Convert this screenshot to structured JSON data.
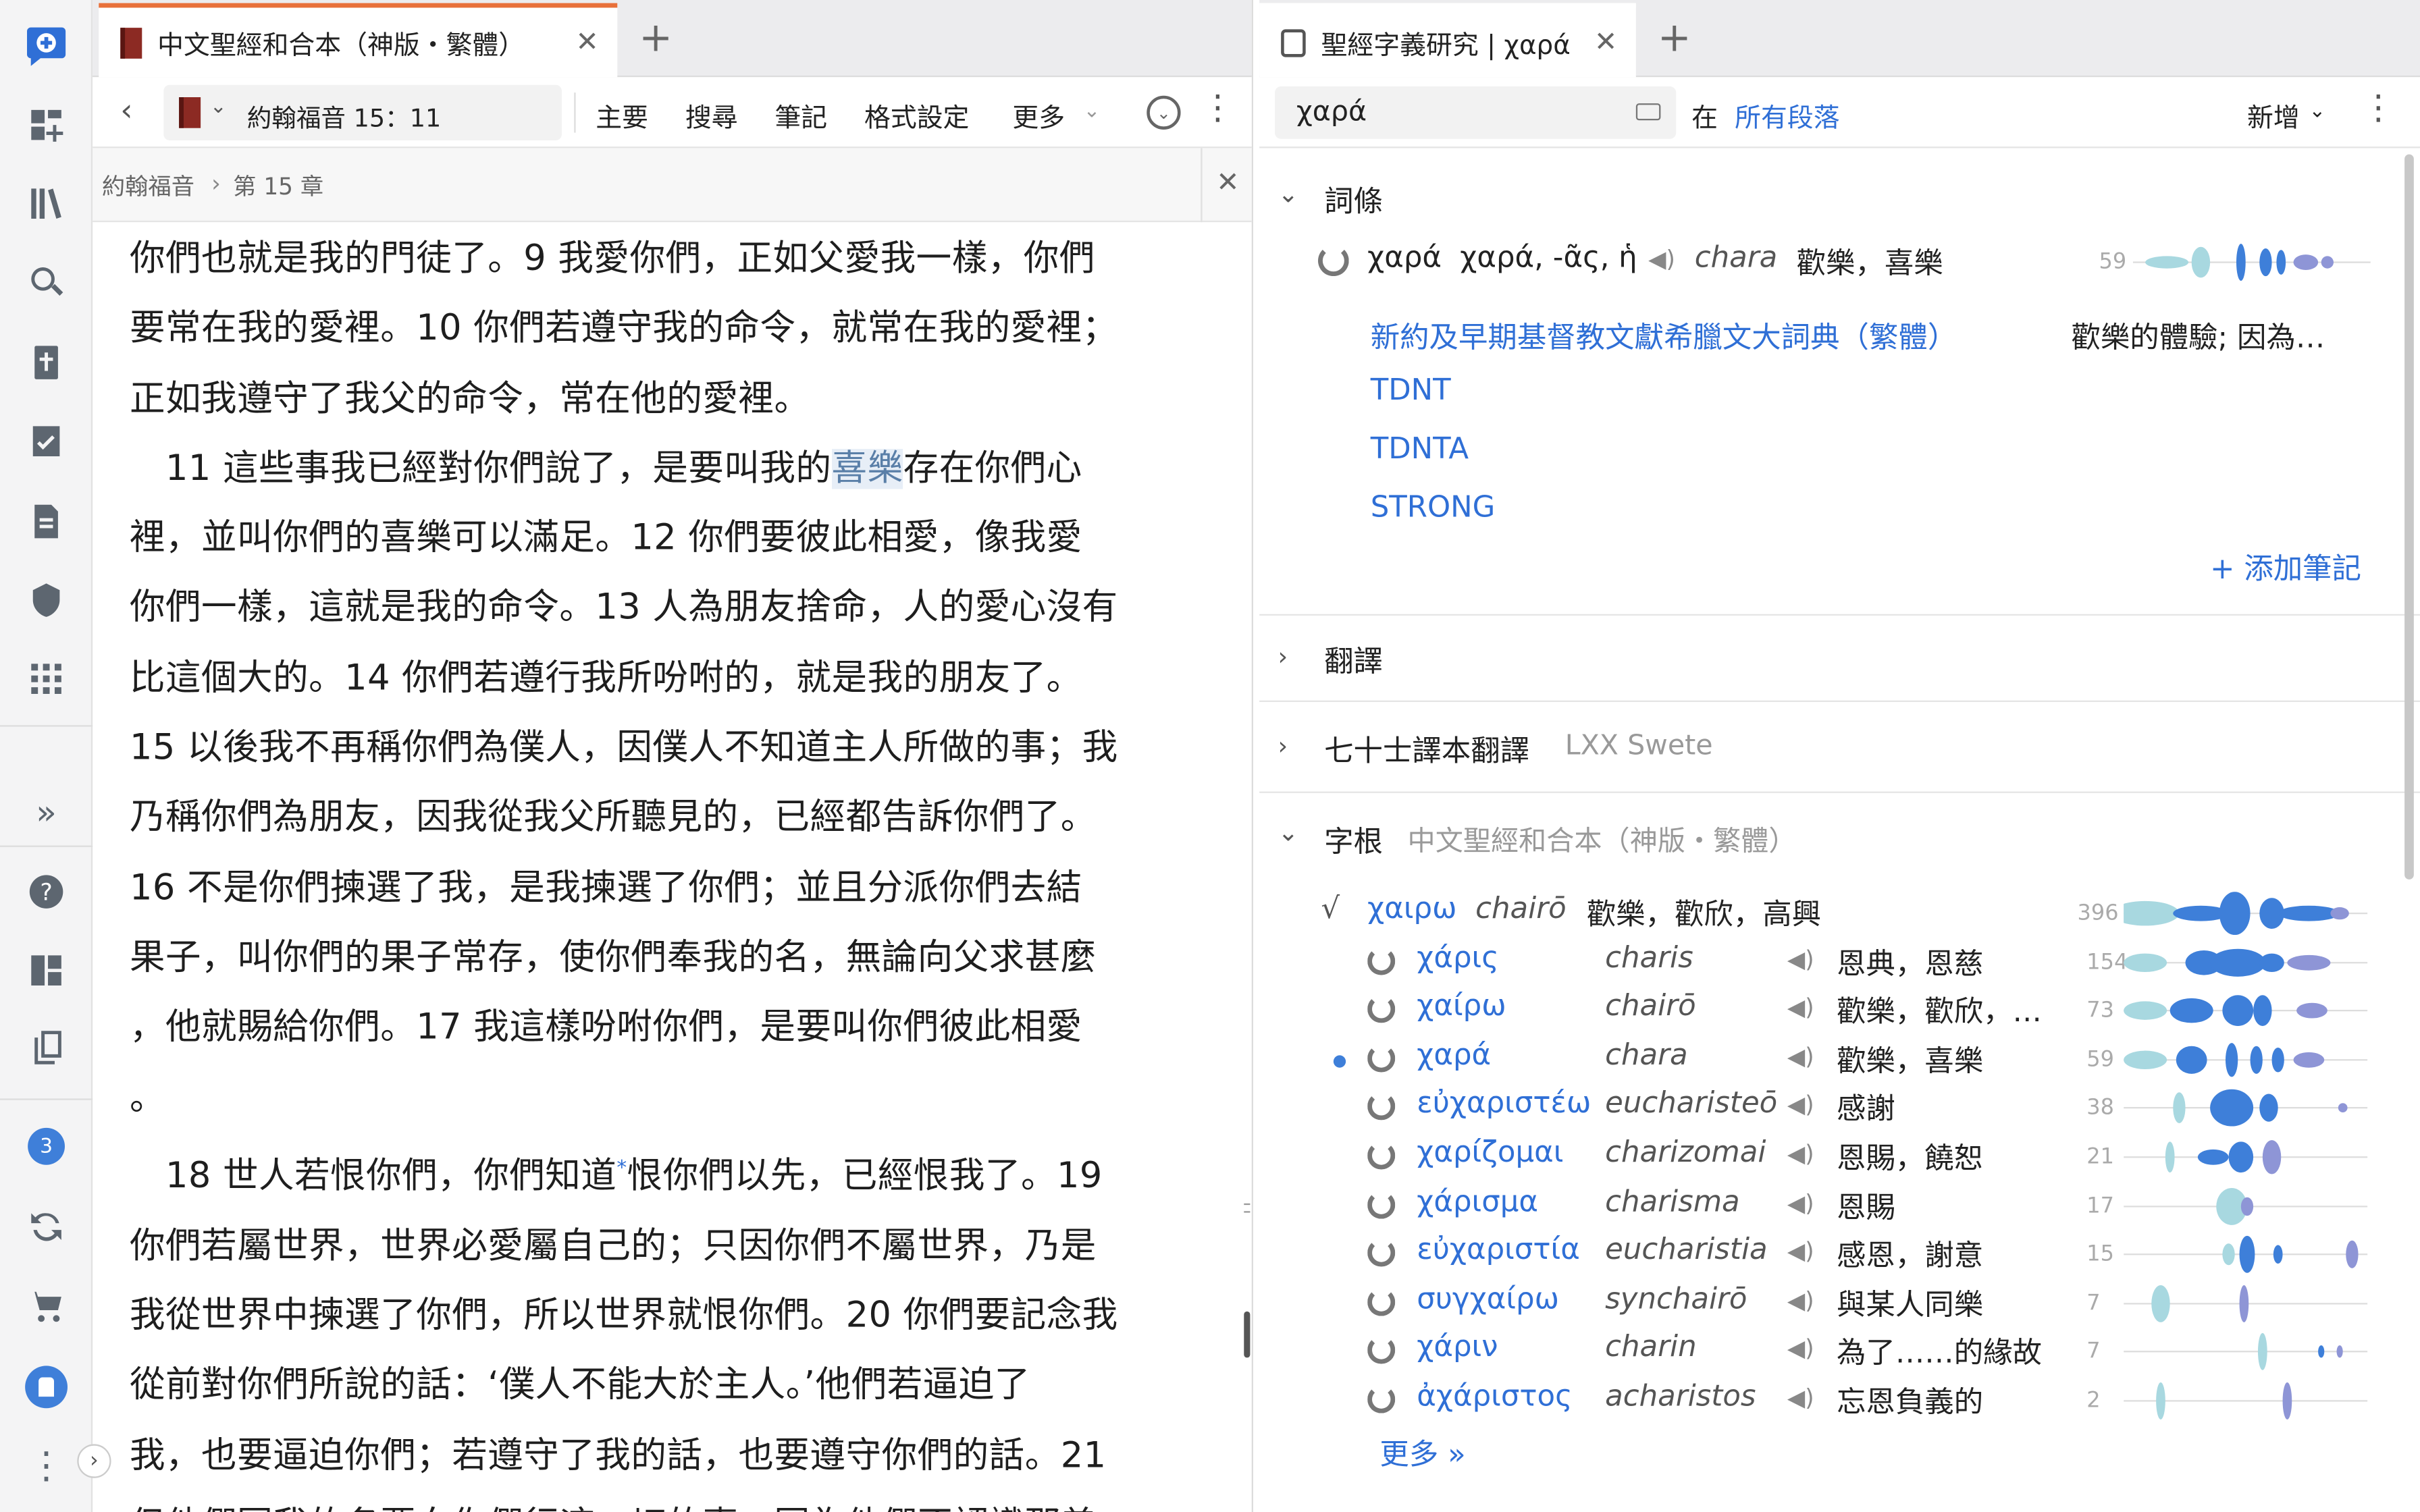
{
  "left_pane": {
    "tab_title": "中文聖經和合本（神版・繁體）",
    "nav_ref": "約翰福音 15：11",
    "menu": [
      "主要",
      "搜尋",
      "筆記",
      "格式設定",
      "更多"
    ],
    "breadcrumb_book": "約翰福音",
    "breadcrumb_chapter": "第 15 章",
    "text_lines": [
      "你們也就是我的門徒了。9 我愛你們，正如父愛我一樣，你們",
      "要常在我的愛裡。10 你們若遵守我的命令，就常在我的愛裡；",
      "正如我遵守了我父的命令，常在他的愛裡。"
    ],
    "hl_before": "　11 這些事我已經對你們說了，是要叫我的",
    "hl_word": "喜樂",
    "hl_after": "存在你們心",
    "text_lines2": [
      "裡，並叫你們的喜樂可以滿足。12 你們要彼此相愛，像我愛",
      "你們一樣，這就是我的命令。13 人為朋友捨命，人的愛心沒有",
      "比這個大的。14 你們若遵行我所吩咐的，就是我的朋友了。",
      "15 以後我不再稱你們為僕人，因僕人不知道主人所做的事；我",
      "乃稱你們為朋友，因我從我父所聽見的，已經都告訴你們了。",
      "16 不是你們揀選了我，是我揀選了你們；並且分派你們去結",
      "果子，叫你們的果子常存，使你們奉我的名，無論向父求甚麼",
      "，他就賜給你們。17 我這樣吩咐你們，是要叫你們彼此相愛",
      "。"
    ],
    "v18_before": "　18 世人若恨你們，你們知道",
    "v18_mark": "*",
    "v18_after": "恨你們以先，已經恨我了。19",
    "text_lines3": [
      "你們若屬世界，世界必愛屬自己的；只因你們不屬世界，乃是",
      "我從世界中揀選了你們，所以世界就恨你們。20 你們要記念我",
      "從前對你們所說的話：‘僕人不能大於主人。’他們若逼迫了",
      "我，也要逼迫你們；若遵守了我的話，也要遵守你們的話。21",
      "但他們因我的名要向你們行這一切的事，因為他們不認識那差"
    ]
  },
  "right_pane": {
    "tab_title": "聖經字義研究 | χαρά",
    "search_value": "χαρά",
    "search_in_label": "在",
    "search_scope": "所有段落",
    "add_label": "新增",
    "section_entry": "詞條",
    "entry": {
      "lemma": "χαρά",
      "form": "χαρά, -ᾶς, ἡ",
      "translit": "chara",
      "gloss": "歡樂，喜樂",
      "count": "59"
    },
    "dict_links": [
      {
        "name": "新約及早期基督教文獻希臘文大詞典（繁體）",
        "desc": "歡樂的體驗; 因為…"
      },
      {
        "name": "TDNT",
        "desc": ""
      },
      {
        "name": "TDNTA",
        "desc": ""
      },
      {
        "name": "STRONG",
        "desc": ""
      }
    ],
    "add_note": "+ 添加筆記",
    "section_translation": "翻譯",
    "section_lxx": "七十士譯本翻譯",
    "section_lxx_source": "LXX Swete",
    "section_root": "字根",
    "section_root_source": "中文聖經和合本（神版・繁體）",
    "root": {
      "greek": "χαιρω",
      "translit": "chairō",
      "gloss": "歡樂，歡欣，高興",
      "count": "396"
    },
    "words": [
      {
        "greek": "χάρις",
        "translit": "charis",
        "gloss": "恩典，恩慈",
        "count": "154"
      },
      {
        "greek": "χαίρω",
        "translit": "chairō",
        "gloss": "歡樂，歡欣，…",
        "count": "73"
      },
      {
        "greek": "χαρά",
        "translit": "chara",
        "gloss": "歡樂，喜樂",
        "count": "59"
      },
      {
        "greek": "εὐχαριστέω",
        "translit": "eucharisteō",
        "gloss": "感謝",
        "count": "38"
      },
      {
        "greek": "χαρίζομαι",
        "translit": "charizomai",
        "gloss": "恩賜，饒恕",
        "count": "21"
      },
      {
        "greek": "χάρισμα",
        "translit": "charisma",
        "gloss": "恩賜",
        "count": "17"
      },
      {
        "greek": "εὐχαριστία",
        "translit": "eucharistia",
        "gloss": "感恩，謝意",
        "count": "15"
      },
      {
        "greek": "συγχαίρω",
        "translit": "synchairō",
        "gloss": "與某人同樂",
        "count": "7"
      },
      {
        "greek": "χάριν",
        "translit": "charin",
        "gloss": "為了……的緣故",
        "count": "7"
      },
      {
        "greek": "ἀχάριστος",
        "translit": "acharistos",
        "gloss": "忘恩負義的",
        "count": "2"
      }
    ],
    "more_label": "更多 »"
  },
  "sidebar": {
    "badge": "3"
  }
}
